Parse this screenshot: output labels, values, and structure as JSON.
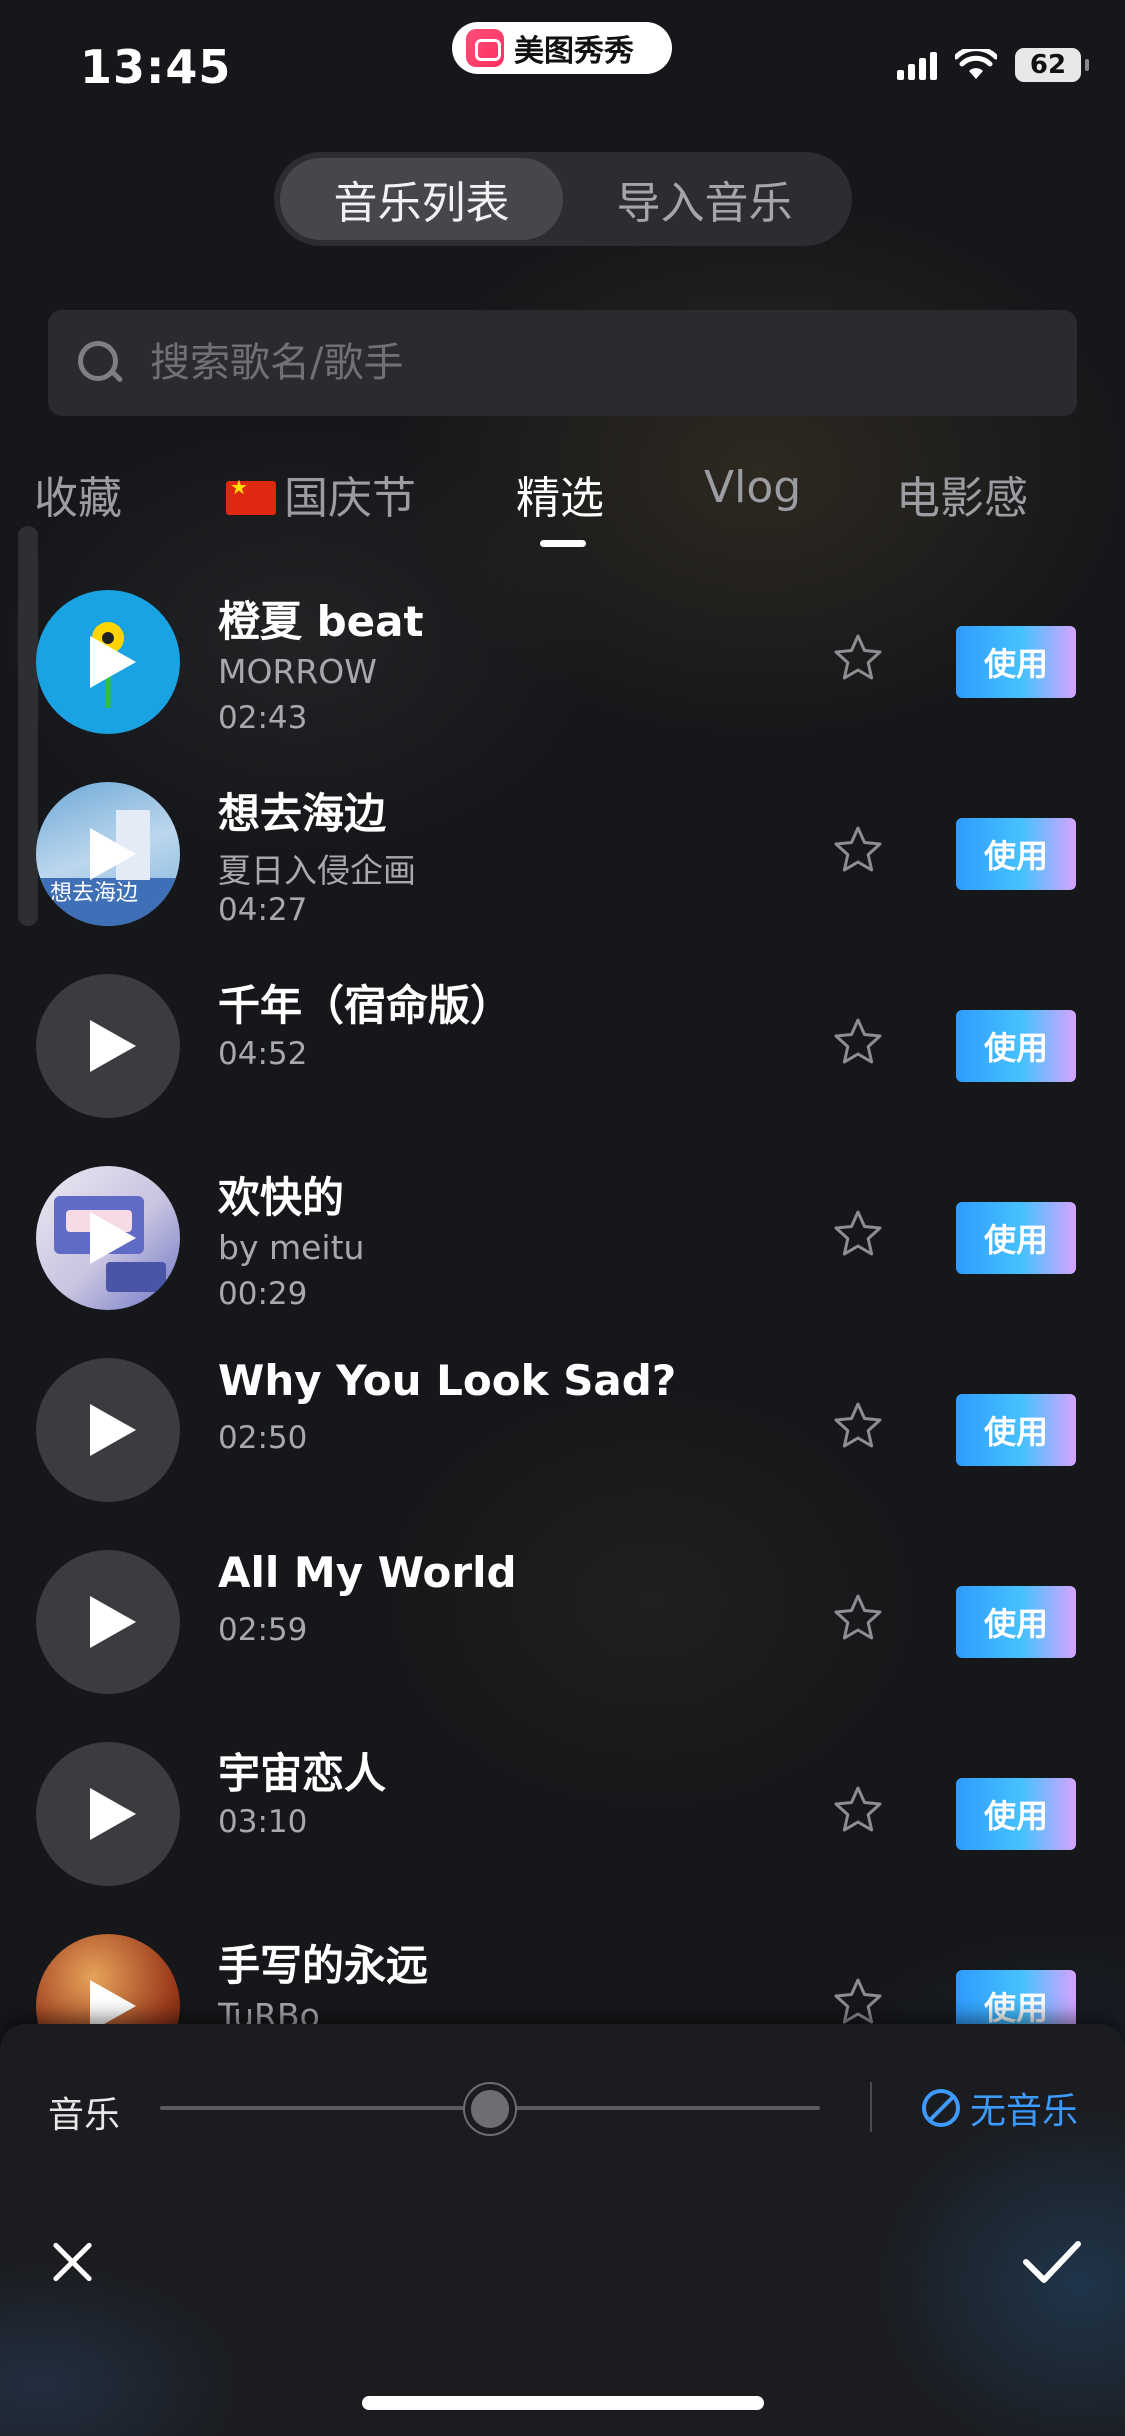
{
  "status_bar": {
    "time": "13:45",
    "app_name": "美图秀秀",
    "battery": "62"
  },
  "segment": {
    "tabs": [
      "音乐列表",
      "导入音乐"
    ],
    "active": 0
  },
  "search": {
    "placeholder": "搜索歌名/歌手"
  },
  "categories": {
    "items": [
      "收藏",
      "国庆节",
      "精选",
      "Vlog",
      "电影感"
    ],
    "active": 2
  },
  "songs": [
    {
      "title": "橙夏 beat",
      "artist": "MORROW",
      "duration": "02:43",
      "cover": "sun",
      "action": "使用"
    },
    {
      "title": "想去海边",
      "artist": "夏日入侵企画",
      "duration": "04:27",
      "cover": "sea",
      "action": "使用"
    },
    {
      "title": "千年（宿命版）",
      "artist": "",
      "duration": "04:52",
      "cover": "dark",
      "action": "使用"
    },
    {
      "title": "欢快的",
      "artist": "by meitu",
      "duration": "00:29",
      "cover": "cassette",
      "action": "使用"
    },
    {
      "title": "Why You Look Sad?",
      "artist": "",
      "duration": "02:50",
      "cover": "dark",
      "action": "使用"
    },
    {
      "title": "All My World",
      "artist": "",
      "duration": "02:59",
      "cover": "dark",
      "action": "使用"
    },
    {
      "title": "宇宙恋人",
      "artist": "",
      "duration": "03:10",
      "cover": "dark",
      "action": "使用"
    },
    {
      "title": "手写的永远",
      "artist": "TuRBo",
      "duration": "",
      "cover": "fire",
      "action": "使用"
    }
  ],
  "bottom": {
    "music_label": "音乐",
    "volume": 0.5,
    "no_music_label": "无音乐"
  },
  "colors": {
    "accent": "#3d9bff",
    "use_gradient_start": "#2f9bff",
    "use_gradient_end": "#d6a3ff"
  },
  "icons": [
    "search-icon",
    "play-icon",
    "star-icon",
    "no-music-icon",
    "close-icon",
    "check-icon",
    "signal-icon",
    "wifi-icon",
    "battery-icon"
  ]
}
